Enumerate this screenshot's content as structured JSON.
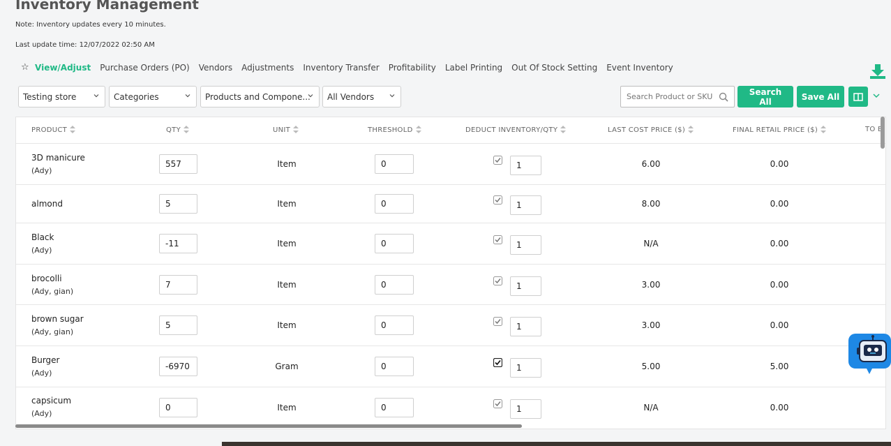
{
  "header": {
    "title": "Inventory Management",
    "note": "Note: Inventory updates every 10 minutes.",
    "last_update": "Last update time: 12/07/2022 02:50 AM"
  },
  "tabs": [
    {
      "label": "View/Adjust",
      "active": true
    },
    {
      "label": "Purchase Orders (PO)"
    },
    {
      "label": "Vendors"
    },
    {
      "label": "Adjustments"
    },
    {
      "label": "Inventory Transfer"
    },
    {
      "label": "Profitability"
    },
    {
      "label": "Label Printing"
    },
    {
      "label": "Out Of Stock Setting"
    },
    {
      "label": "Event Inventory"
    }
  ],
  "filters": {
    "store": "Testing store",
    "categories": "Categories",
    "product_type": "Products and Compone...",
    "vendors": "All Vendors",
    "search_placeholder": "Search Product or SKU"
  },
  "buttons": {
    "search_all": "Search All",
    "save_all": "Save All"
  },
  "colors": {
    "accent": "#20b986",
    "chat_bot": "#1e88e5"
  },
  "table": {
    "headers": [
      "PRODUCT",
      "QTY",
      "UNIT",
      "THRESHOLD",
      "DEDUCT INVENTORY/QTY",
      "LAST COST PRICE ($)",
      "FINAL RETAIL PRICE ($)",
      "TO B"
    ],
    "rows": [
      {
        "name": "3D manicure",
        "sub": "(Ady)",
        "qty": "557",
        "unit": "Item",
        "threshold": "0",
        "deduct": true,
        "deduct_qty": "1",
        "last_cost": "6.00",
        "final_retail": "0.00"
      },
      {
        "name": "almond",
        "sub": "",
        "qty": "5",
        "unit": "Item",
        "threshold": "0",
        "deduct": true,
        "deduct_qty": "1",
        "last_cost": "8.00",
        "final_retail": "0.00"
      },
      {
        "name": "Black",
        "sub": "(Ady)",
        "qty": "-11",
        "unit": "Item",
        "threshold": "0",
        "deduct": true,
        "deduct_qty": "1",
        "last_cost": "N/A",
        "final_retail": "0.00"
      },
      {
        "name": "brocolli",
        "sub": "(Ady, gian)",
        "qty": "7",
        "unit": "Item",
        "threshold": "0",
        "deduct": true,
        "deduct_qty": "1",
        "last_cost": "3.00",
        "final_retail": "0.00"
      },
      {
        "name": "brown sugar",
        "sub": "(Ady, gian)",
        "qty": "5",
        "unit": "Item",
        "threshold": "0",
        "deduct": true,
        "deduct_qty": "1",
        "last_cost": "3.00",
        "final_retail": "0.00"
      },
      {
        "name": "Burger",
        "sub": "(Ady)",
        "qty": "-6970",
        "unit": "Gram",
        "threshold": "0",
        "deduct": true,
        "deduct_qty": "1",
        "last_cost": "5.00",
        "final_retail": "5.00"
      },
      {
        "name": "capsicum",
        "sub": "(Ady)",
        "qty": "0",
        "unit": "Item",
        "threshold": "0",
        "deduct": true,
        "deduct_qty": "1",
        "last_cost": "N/A",
        "final_retail": "0.00"
      }
    ]
  }
}
